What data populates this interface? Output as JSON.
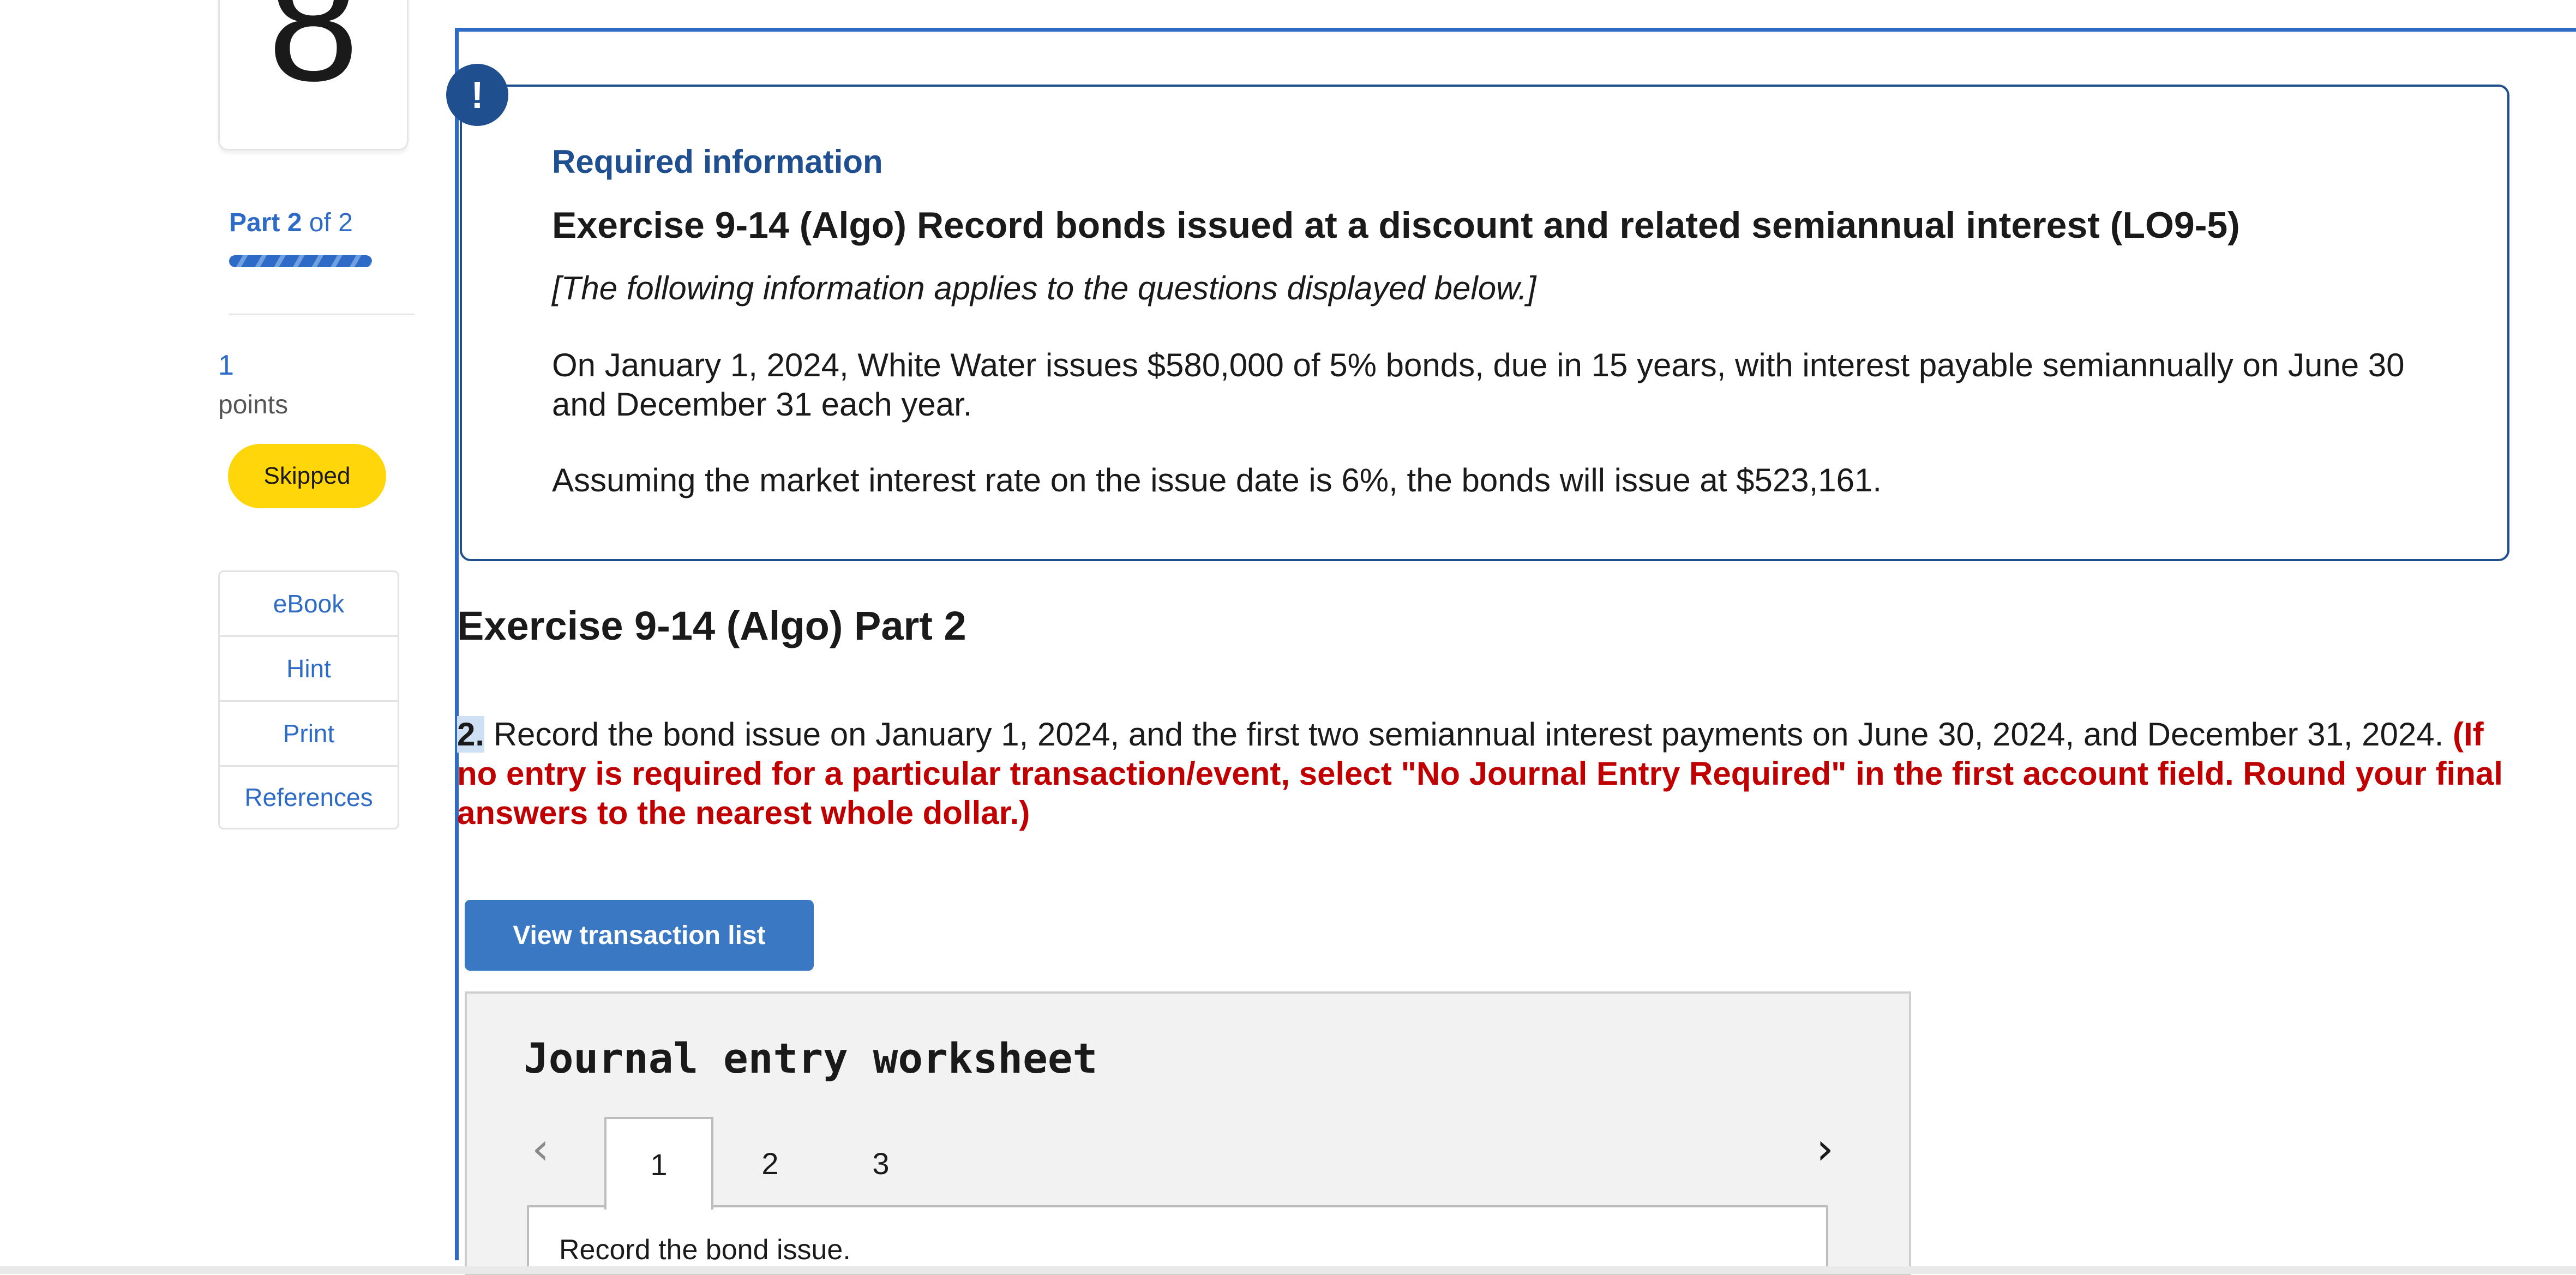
{
  "rail": {
    "question_number": "8",
    "part_label_bold": "Part 2",
    "part_label_rest": " of 2",
    "part_progress": 1.0,
    "points_value": "1",
    "points_label": "points",
    "status_badge": "Skipped",
    "tools": [
      "eBook",
      "Hint",
      "Print",
      "References"
    ]
  },
  "info": {
    "badge": "!",
    "heading": "Required information",
    "title": "Exercise 9-14 (Algo) Record bonds issued at a discount and related semiannual interest (LO9-5)",
    "applies": "[The following information applies to the questions displayed below.]",
    "paragraph1": "On January 1, 2024, White Water issues $580,000 of 5% bonds, due in 15 years, with interest payable semiannually on June 30 and December 31 each year.",
    "paragraph2": "Assuming the market interest rate on the issue date is 6%, the bonds will issue at $523,161."
  },
  "part": {
    "title": "Exercise 9-14 (Algo) Part 2",
    "question_number": "2.",
    "question_text": " Record the bond issue on January 1, 2024, and the first two semiannual interest payments on June 30, 2024, and December 31, 2024. ",
    "question_note": "(If no entry is required for a particular transaction/event, select \"No Journal Entry Required\" in the first account field. Round your final answers to the nearest whole dollar.)"
  },
  "view_button": "View transaction list",
  "worksheet": {
    "title": "Journal entry worksheet",
    "prev_icon": "‹",
    "next_icon": "›",
    "tabs": [
      "1",
      "2",
      "3"
    ],
    "panel_text": "Record the bond issue."
  },
  "colors": {
    "accent": "#2e6bc6",
    "info_border": "#1f4f8f",
    "note_red": "#c00000",
    "skipped": "#ffd60a"
  }
}
